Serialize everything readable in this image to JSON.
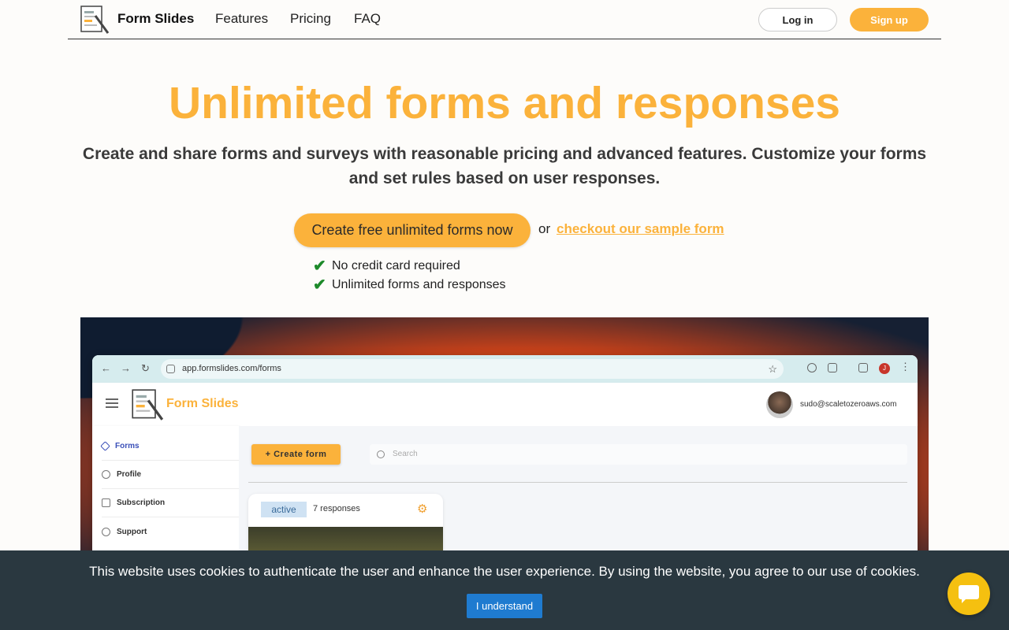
{
  "nav": {
    "brand": "Form Slides",
    "links": [
      "Features",
      "Pricing",
      "FAQ"
    ],
    "login_label": "Log in",
    "signup_label": "Sign up"
  },
  "hero": {
    "title": "Unlimited forms and responses",
    "subtitle": "Create and share forms and surveys with reasonable pricing and advanced features. Customize your forms and set rules based on user responses.",
    "cta_label": "Create free unlimited forms now",
    "or_text": "or",
    "sample_link": "checkout our sample form",
    "checks": [
      "No credit card required",
      "Unlimited forms and responses"
    ]
  },
  "screenshot": {
    "url": "app.formslides.com/forms",
    "app_brand": "Form Slides",
    "user_email": "sudo@scaletozeroaws.com",
    "profile_initial": "J",
    "sidebar": [
      "Forms",
      "Profile",
      "Subscription",
      "Support"
    ],
    "create_form_label": "+ Create form",
    "search_placeholder": "Search",
    "card": {
      "status": "active",
      "responses": "7 responses"
    }
  },
  "cookie": {
    "text": "This website uses cookies to authenticate the user and enhance the user experience. By using the website, you agree to our use of cookies.",
    "button_label": "I understand"
  },
  "colors": {
    "accent": "#fbb23b",
    "cookie_bg": "#2a3840",
    "cookie_button": "#1f7bd0",
    "check": "#1d8a2a"
  },
  "icons": [
    "logo-icon",
    "check-icon",
    "hamburger-icon",
    "search-icon",
    "gear-icon",
    "star-icon",
    "chat-icon"
  ]
}
